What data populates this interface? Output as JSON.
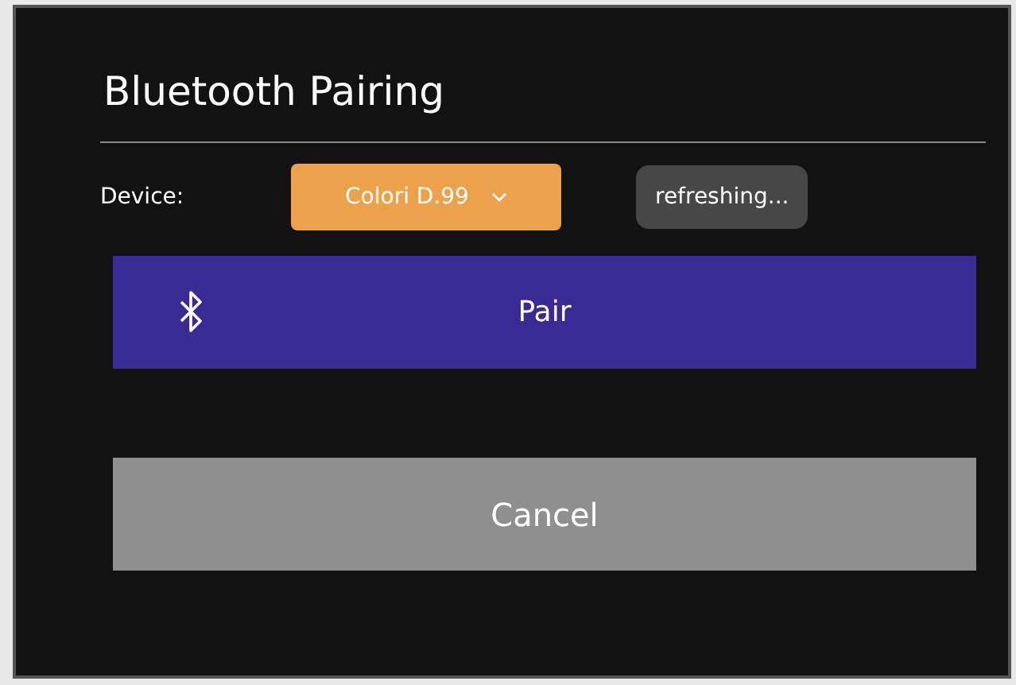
{
  "window": {
    "title": "Bluetooth Pairing"
  },
  "device": {
    "label": "Device:",
    "value": "Colori D.99"
  },
  "refresh_button": {
    "label": "refreshing..."
  },
  "pair_button": {
    "label": "Pair"
  },
  "cancel_button": {
    "label": "Cancel"
  }
}
